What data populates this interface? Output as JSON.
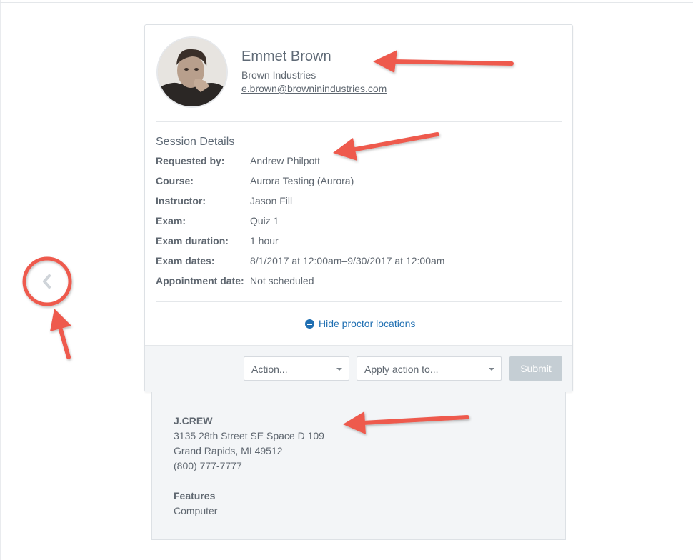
{
  "profile": {
    "name": "Emmet Brown",
    "company": "Brown Industries",
    "email": "e.brown@browninindustries.com"
  },
  "session": {
    "title": "Session Details",
    "rows": [
      {
        "label": "Requested by:",
        "value": "Andrew Philpott"
      },
      {
        "label": "Course:",
        "value": "Aurora Testing (Aurora)"
      },
      {
        "label": "Instructor:",
        "value": "Jason Fill"
      },
      {
        "label": "Exam:",
        "value": "Quiz 1"
      },
      {
        "label": "Exam duration:",
        "value": "1 hour"
      },
      {
        "label": "Exam dates:",
        "value": "8/1/2017 at 12:00am–9/30/2017 at 12:00am"
      },
      {
        "label": "Appointment date:",
        "value": "Not scheduled"
      }
    ],
    "toggle_label": "Hide proctor locations"
  },
  "actions": {
    "action_select": "Action...",
    "apply_select": "Apply action to...",
    "submit_label": "Submit"
  },
  "location": {
    "name": "J.CREW",
    "address1": "3135 28th Street SE Space D 109",
    "address2": "Grand Rapids, MI 49512",
    "phone": "(800) 777-7777",
    "features_heading": "Features",
    "features": "Computer"
  },
  "icons": {
    "prev": "chevron-left-icon",
    "toggle": "minus-circle-icon"
  },
  "colors": {
    "link": "#1f6fb2",
    "annotation": "#ee5a4e",
    "submit_disabled": "#c5ced4"
  }
}
